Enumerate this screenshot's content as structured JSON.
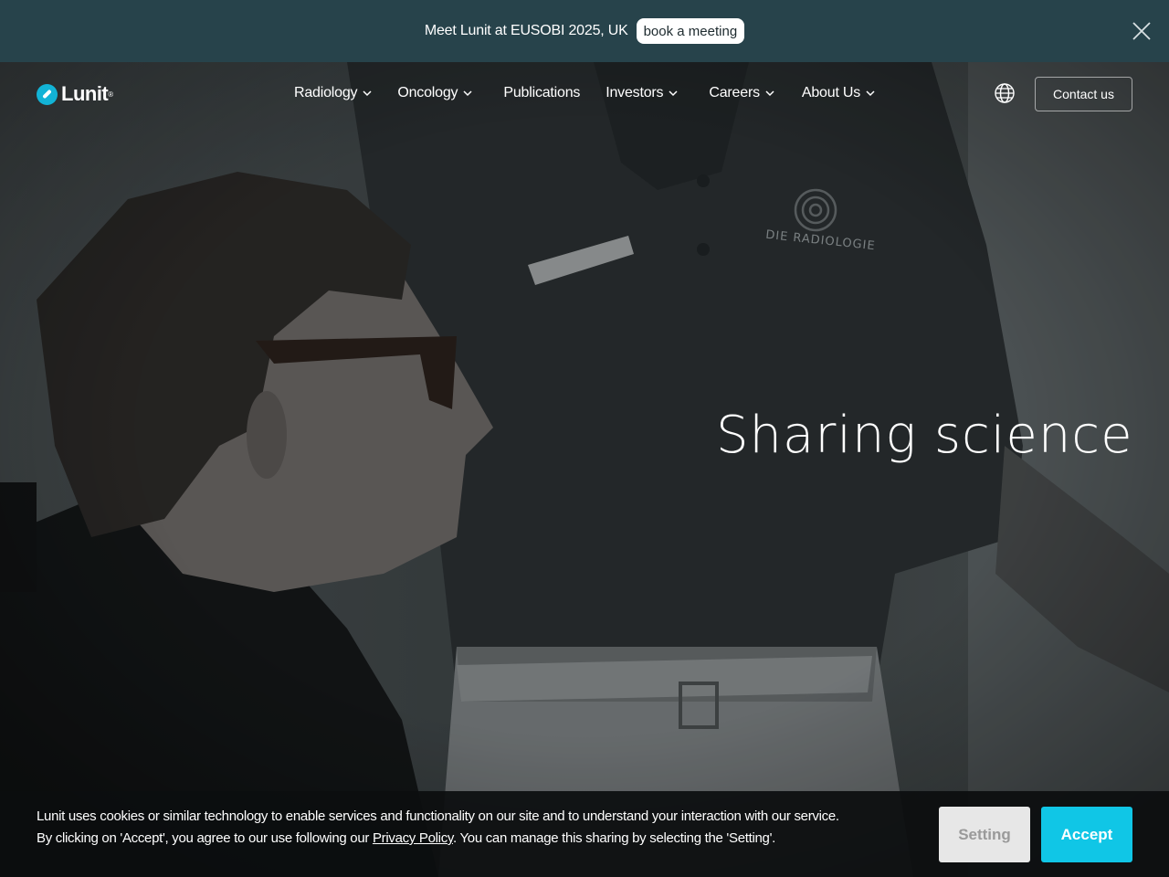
{
  "announcement": {
    "message": "Meet Lunit at EUSOBI 2025, UK",
    "button_label": "book a meeting",
    "close_icon": "close-icon"
  },
  "nav": {
    "logo_text": "Lunit",
    "logo_mark": "®",
    "items": [
      {
        "label": "Radiology",
        "has_dropdown": true
      },
      {
        "label": "Oncology",
        "has_dropdown": true
      },
      {
        "label": "Publications",
        "has_dropdown": false
      },
      {
        "label": "Investors",
        "has_dropdown": true
      },
      {
        "label": "Careers",
        "has_dropdown": true
      },
      {
        "label": "About Us",
        "has_dropdown": true
      }
    ],
    "language_icon": "globe-icon",
    "contact_label": "Contact us"
  },
  "hero": {
    "headline": "Sharing science",
    "shirt_logo_text": "DIE RADIOLOGIE"
  },
  "cookie": {
    "line1": "Lunit uses cookies or similar technology to enable services and functionality on our site and to understand your interaction with our service.",
    "line2_before": "By clicking on 'Accept', you agree to our use following our ",
    "privacy_link": "Privacy Policy",
    "line2_after": ". You can manage this sharing by selecting the 'Setting'.",
    "setting_label": "Setting",
    "accept_label": "Accept"
  },
  "colors": {
    "announcement_bg": "#27434b",
    "brand_cyan": "#10c6e6",
    "cookie_bg": "#0c0e0f"
  }
}
